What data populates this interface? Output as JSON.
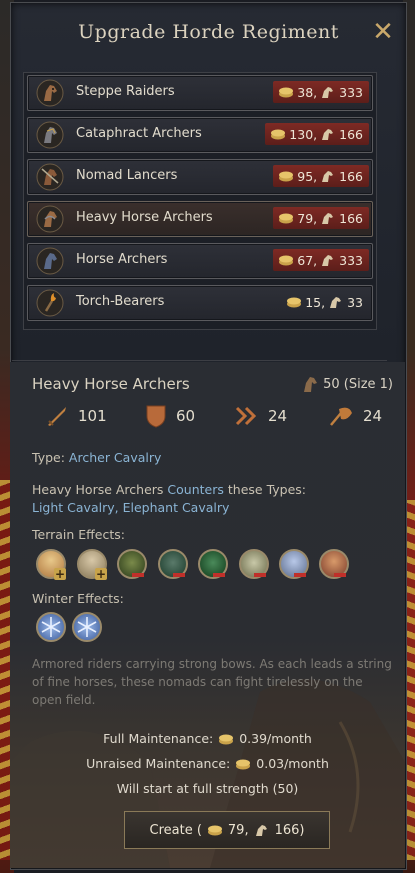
{
  "dialog": {
    "title": "Upgrade Horde Regiment"
  },
  "regiments": [
    {
      "name": "Steppe Raiders",
      "gold": "38,",
      "horses": "333",
      "cost_warning": true
    },
    {
      "name": "Cataphract Archers",
      "gold": "130,",
      "horses": "166",
      "cost_warning": true
    },
    {
      "name": "Nomad Lancers",
      "gold": "95,",
      "horses": "166",
      "cost_warning": true
    },
    {
      "name": "Heavy Horse Archers",
      "gold": "79,",
      "horses": "166",
      "cost_warning": true,
      "selected": true
    },
    {
      "name": "Horse Archers",
      "gold": "67,",
      "horses": "333",
      "cost_warning": true
    },
    {
      "name": "Torch-Bearers",
      "gold": "15,",
      "horses": "33",
      "cost_warning": false
    }
  ],
  "detail": {
    "name": "Heavy Horse Archers",
    "size": "50 (Size 1)",
    "stats": {
      "damage": "101",
      "toughness": "60",
      "pursuit": "24",
      "screen": "24"
    },
    "type_label": "Type:",
    "type_value": "Archer Cavalry",
    "counters_prefix": "Heavy Horse Archers",
    "counters_word": "Counters",
    "counters_suffix": "these Types:",
    "counters_list": "Light Cavalry, Elephant Cavalry",
    "terrain_label": "Terrain Effects:",
    "winter_label": "Winter Effects:",
    "description": "Armored riders carrying strong bows. As each leads a string of fine horses, these nomads can fight tirelessly on the open field.",
    "full_maint_label": "Full Maintenance:",
    "full_maint_value": "0.39/month",
    "unraised_maint_label": "Unraised Maintenance:",
    "unraised_maint_value": "0.03/month",
    "strength_note": "Will start at full strength (50)"
  },
  "create_button": {
    "label": "Create (",
    "gold": "79,",
    "horses": "166)"
  },
  "colors": {
    "accent_gold": "#c9a86a",
    "link_blue": "#8ab4d4",
    "warning_red": "#7e2a24"
  }
}
